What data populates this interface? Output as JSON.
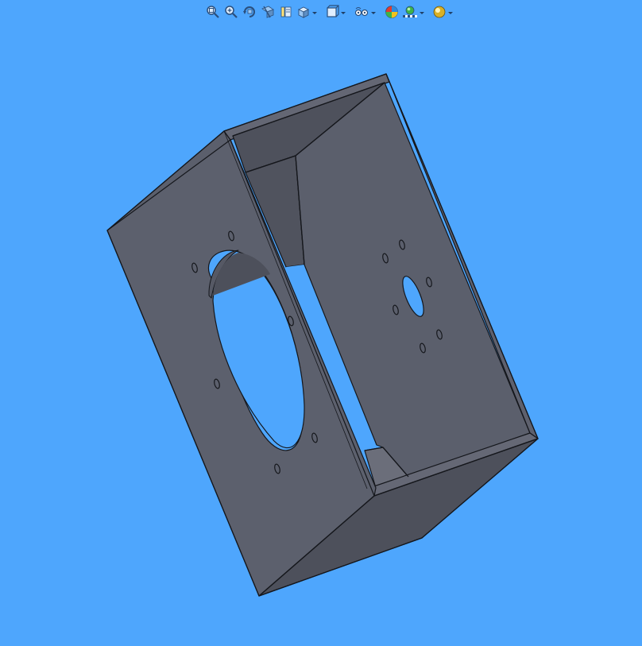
{
  "view": {
    "background": "#4ea6fd",
    "model_colors": {
      "front_face": "#5c606d",
      "right_face": "#5b5f6c",
      "dark_face": "#4d505b",
      "light_face": "#6b6e7a",
      "edge": "#15171c"
    }
  },
  "toolbar": {
    "items": [
      {
        "icon": "zoom-to-fit-icon",
        "has_dropdown": false
      },
      {
        "icon": "zoom-to-area-icon",
        "has_dropdown": false
      },
      {
        "icon": "previous-view-icon",
        "has_dropdown": false
      },
      {
        "icon": "section-view-icon",
        "has_dropdown": false
      },
      {
        "icon": "dynamic-annotation-views-icon",
        "has_dropdown": false
      },
      {
        "icon": "view-orientation-icon",
        "has_dropdown": true
      },
      {
        "icon": "display-style-icon",
        "has_dropdown": true
      },
      {
        "icon": "hide-show-items-icon",
        "has_dropdown": true
      },
      {
        "icon": "edit-appearance-icon",
        "has_dropdown": false
      },
      {
        "icon": "apply-scene-icon",
        "has_dropdown": true
      },
      {
        "icon": "view-settings-icon",
        "has_dropdown": true
      }
    ]
  }
}
